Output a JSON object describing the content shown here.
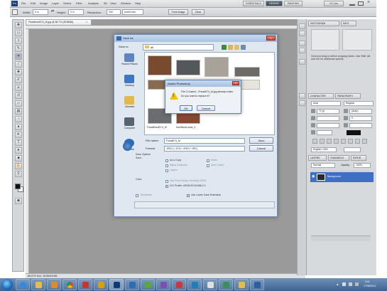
{
  "menubar": {
    "items": [
      "File",
      "Edit",
      "Image",
      "Layer",
      "Select",
      "Filter",
      "Analysis",
      "3D",
      "View",
      "Window",
      "Help"
    ],
    "workspaces": [
      "ESSENTIALS",
      "DESIGN",
      "PAINTING"
    ],
    "active_workspace": "DESIGN",
    "search_label": "CS Live"
  },
  "options": {
    "width_label": "Width:",
    "width_value": "6 in",
    "height_label": "Height:",
    "height_value": "9 in",
    "resolution_label": "Resolution:",
    "resolution_value": "300",
    "resolution_unit": "pixels/inch",
    "front_image_label": "Front Image",
    "clear_label": "Clear"
  },
  "document": {
    "tab_title": "Flossfixed074_M.jpg @ 66.7% (RGB/8#)",
    "status_text": "66.67%  Doc: 18.6M/18.6M"
  },
  "save_dialog": {
    "title": "Save As",
    "save_in_label": "Save in:",
    "save_in_value": "all",
    "places": [
      "Recent Places",
      "Desktop",
      "Libraries",
      "Computer",
      "Network"
    ],
    "files": [
      "",
      "",
      "",
      "",
      "",
      "",
      "",
      "FossilfixedD74_M",
      "NortNeutLooks_3"
    ],
    "file_name_label": "File name:",
    "file_name_value": "Fossil074_M",
    "format_label": "Format:",
    "format_value": "JPEG (*.JPG;*.JPEG;*.JPE)",
    "save_label": "Save",
    "cancel_label": "Cancel",
    "save_options_label": "Save Options",
    "save_sub_label": "Save:",
    "as_copy_label": "As a Copy",
    "notes_label": "Notes",
    "alpha_label": "Alpha Channels",
    "spot_label": "Spot Colors",
    "layers_label": "Layers",
    "color_label": "Color:",
    "proof_label": "Use Proof Setup: Working CMYK",
    "icc_label": "ICC Profile: sRGB IEC61966-2.1",
    "thumbnail_label": "Thumbnail",
    "lowercase_label": "Use Lower Case Extension"
  },
  "confirm_dialog": {
    "title": "Adobe Photoshop",
    "message_line1": "File C:\\Users\\...\\Fossil074_M.jpg already exists.",
    "message_line2": "Do you want to replace it?",
    "ok_label": "OK",
    "cancel_label": "Cancel"
  },
  "panels": {
    "tabs_top": [
      "HISTOGRAM",
      "INFO"
    ],
    "tabs_mid": [
      "CHARACTER",
      "PARAGRAPH"
    ],
    "hint_text": "Click and drag to define cropping frame. Use Shift, Alt, and Ctrl for additional options.",
    "font_family": "Arial",
    "font_style": "Regular",
    "font_size": "72 pt",
    "leading": "(Auto)",
    "tracking": "0",
    "language": "English: USA",
    "tabs_layers": [
      "LAYERS",
      "CHANNELS",
      "PATHS"
    ],
    "blend_mode": "Normal",
    "opacity_label": "Opacity:",
    "opacity_value": "100%",
    "layer_name": "Background"
  },
  "taskbar": {
    "time": "3:01",
    "date": "17/08/2012"
  },
  "colors": {
    "taskbar": "#4a70a0",
    "layer_selected": "#3d6fc4",
    "workspace_active": "#4a5866"
  }
}
